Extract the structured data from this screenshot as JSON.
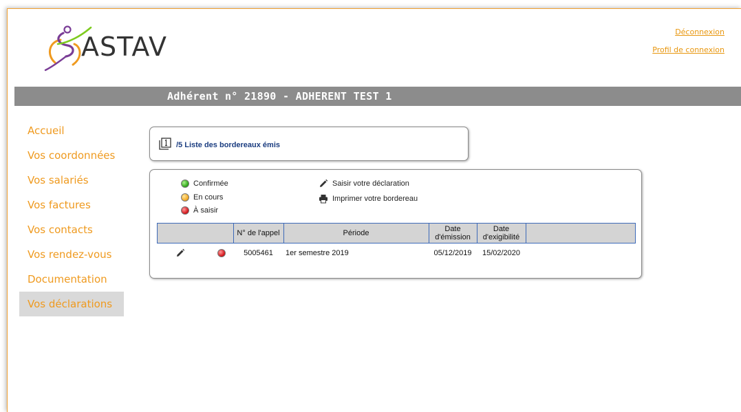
{
  "brand": {
    "logo_text": "ASTAV"
  },
  "header": {
    "logout_link": "Déconnexion",
    "profile_link": "Profil de connexion"
  },
  "banner": {
    "title": "Adhérent n° 21890 - ADHERENT TEST 1"
  },
  "sidebar": {
    "items": [
      {
        "label": "Accueil"
      },
      {
        "label": "Vos coordonnées"
      },
      {
        "label": "Vos salariés"
      },
      {
        "label": "Vos factures"
      },
      {
        "label": "Vos contacts"
      },
      {
        "label": "Vos rendez-vous"
      },
      {
        "label": "Documentation"
      },
      {
        "label": "Vos déclarations"
      }
    ]
  },
  "step": {
    "label": "/5 Liste des bordereaux émis",
    "icon": "page-1-icon"
  },
  "legend": {
    "statuses": [
      {
        "label": "Confirmée",
        "color": "#2fa81a"
      },
      {
        "label": "En cours",
        "color": "#f2a925"
      },
      {
        "label": "À saisir",
        "color": "#d4161b"
      }
    ],
    "actions": [
      {
        "label": "Saisir votre déclaration",
        "icon": "pencil-icon"
      },
      {
        "label": "Imprimer votre bordereau",
        "icon": "printer-icon"
      }
    ]
  },
  "table": {
    "headers": {
      "num": "N° de l'appel",
      "period": "Période",
      "emission_1": "Date",
      "emission_2": "d'émission",
      "due_1": "Date",
      "due_2": "d'exigibilité"
    },
    "rows": [
      {
        "num": "5005461",
        "period": "1er semestre 2019",
        "emission": "05/12/2019",
        "due": "15/02/2020",
        "status": "À saisir"
      }
    ]
  },
  "colors": {
    "accent": "#ef9a1f",
    "banner": "#8c8c8c",
    "link": "#1b3d80",
    "table_border": "#3c69b8"
  }
}
